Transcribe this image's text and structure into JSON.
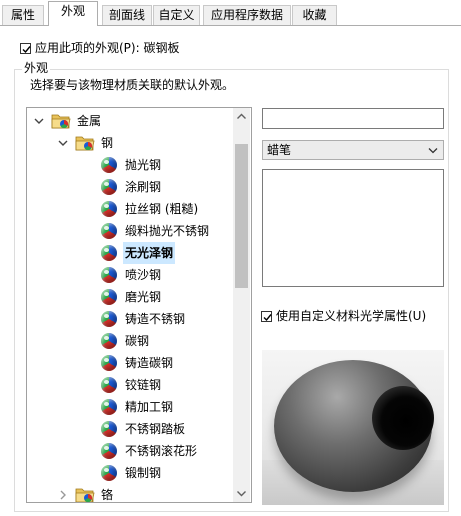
{
  "tabs": [
    {
      "label": "属性"
    },
    {
      "label": "外观"
    },
    {
      "label": "剖面线"
    },
    {
      "label": "自定义"
    },
    {
      "label": "应用程序数据"
    },
    {
      "label": "收藏"
    }
  ],
  "active_tab": "外观",
  "apply_appearance": {
    "checked": true,
    "label": "应用此项的外观(P): 碳钢板"
  },
  "appearance_group": {
    "title": "外观",
    "description": "选择要与该物理材质关联的默认外观。"
  },
  "tree": {
    "root": {
      "label": "金属",
      "expanded": true
    },
    "folder": {
      "label": "钢",
      "expanded": true
    },
    "items": [
      {
        "label": "抛光钢"
      },
      {
        "label": "涂刷钢"
      },
      {
        "label": "拉丝钢 (粗糙)"
      },
      {
        "label": "缎料抛光不锈钢"
      },
      {
        "label": "无光泽钢",
        "selected": true
      },
      {
        "label": "喷沙钢"
      },
      {
        "label": "磨光钢"
      },
      {
        "label": "铸造不锈钢"
      },
      {
        "label": "碳钢"
      },
      {
        "label": "铸造碳钢"
      },
      {
        "label": "铰链钢"
      },
      {
        "label": "精加工钢"
      },
      {
        "label": "不锈钢踏板"
      },
      {
        "label": "不锈钢滚花形"
      },
      {
        "label": "锻制钢"
      }
    ],
    "next_folder": {
      "label": "铬",
      "expanded": false
    }
  },
  "right_panel": {
    "name_value": "",
    "dropdown_value": "蜡笔",
    "textarea_value": "",
    "custom_optics": {
      "checked": true,
      "label": "使用自定义材料光学属性(U)"
    }
  },
  "colors": {
    "selection": "#cce8ff",
    "folder": "#e8c25a"
  }
}
